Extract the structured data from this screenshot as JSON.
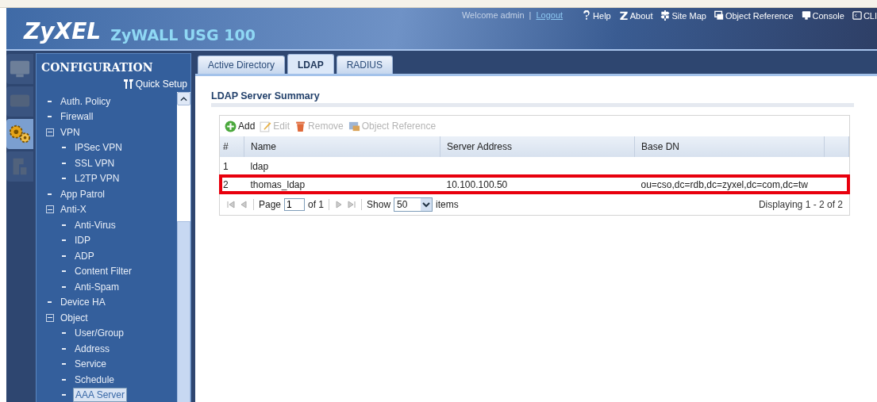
{
  "header": {
    "logo": "ZyXEL",
    "product": "ZyWALL USG 100",
    "welcome": "Welcome admin",
    "separator": "|",
    "logout": "Logout",
    "links": [
      {
        "kind": "help",
        "label": "Help"
      },
      {
        "kind": "about",
        "label": "About"
      },
      {
        "kind": "sitemap",
        "label": "Site Map"
      },
      {
        "kind": "objref",
        "label": "Object Reference"
      },
      {
        "kind": "console",
        "label": "Console"
      },
      {
        "kind": "cli",
        "label": "CLI"
      }
    ]
  },
  "rail": [
    {
      "kind": "monitor",
      "selected": false
    },
    {
      "kind": "box",
      "selected": false
    },
    {
      "kind": "gear",
      "selected": true
    },
    {
      "kind": "maintenance",
      "selected": false
    }
  ],
  "sidebar": {
    "title": "CONFIGURATION",
    "quick_setup": "Quick Setup",
    "items": [
      {
        "label": "Auth. Policy",
        "selected": false
      },
      {
        "label": "Firewall",
        "selected": false
      },
      {
        "label": "VPN",
        "selected": false,
        "expanded": true,
        "children": [
          {
            "label": "IPSec VPN",
            "selected": false
          },
          {
            "label": "SSL VPN",
            "selected": false
          },
          {
            "label": "L2TP VPN",
            "selected": false
          }
        ]
      },
      {
        "label": "App Patrol",
        "selected": false
      },
      {
        "label": "Anti-X",
        "selected": false,
        "expanded": true,
        "children": [
          {
            "label": "Anti-Virus",
            "selected": false
          },
          {
            "label": "IDP",
            "selected": false
          },
          {
            "label": "ADP",
            "selected": false
          },
          {
            "label": "Content Filter",
            "selected": false
          },
          {
            "label": "Anti-Spam",
            "selected": false
          }
        ]
      },
      {
        "label": "Device HA",
        "selected": false
      },
      {
        "label": "Object",
        "selected": false,
        "expanded": true,
        "children": [
          {
            "label": "User/Group",
            "selected": false
          },
          {
            "label": "Address",
            "selected": false
          },
          {
            "label": "Service",
            "selected": false
          },
          {
            "label": "Schedule",
            "selected": false
          },
          {
            "label": "AAA Server",
            "selected": true
          }
        ]
      }
    ]
  },
  "tabs": [
    {
      "label": "Active Directory",
      "selected": false
    },
    {
      "label": "LDAP",
      "selected": true
    },
    {
      "label": "RADIUS",
      "selected": false
    }
  ],
  "section_title": "LDAP Server Summary",
  "toolbar": [
    {
      "kind": "add",
      "label": "Add",
      "disabled": false
    },
    {
      "kind": "edit",
      "label": "Edit",
      "disabled": true
    },
    {
      "kind": "remove",
      "label": "Remove",
      "disabled": true
    },
    {
      "kind": "objref",
      "label": "Object Reference",
      "disabled": true
    }
  ],
  "table": {
    "columns": [
      "#",
      "Name",
      "Server Address",
      "Base DN"
    ],
    "rows": [
      {
        "cells": [
          "1",
          "ldap",
          "",
          ""
        ],
        "highlighted": false
      },
      {
        "cells": [
          "2",
          "thomas_ldap",
          "10.100.100.50",
          "ou=cso,dc=rdb,dc=zyxel,dc=com,dc=tw"
        ],
        "highlighted": true
      }
    ]
  },
  "pager": {
    "page_label": "Page",
    "page": "1",
    "of": "of 1",
    "show_label": "Show",
    "show": "50",
    "items_label": "items",
    "summary": "Displaying 1 - 2 of 2"
  }
}
